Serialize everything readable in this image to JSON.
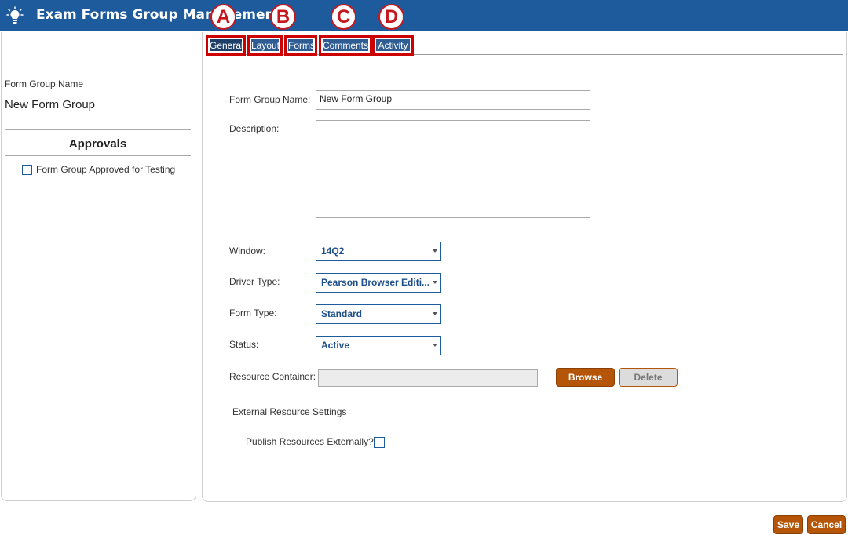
{
  "app": {
    "title": "Exam Forms Group Management"
  },
  "callouts": [
    "A",
    "B",
    "C",
    "D"
  ],
  "tabs": [
    {
      "label": "General",
      "active": true
    },
    {
      "label": "Layout"
    },
    {
      "label": "Forms"
    },
    {
      "label": "Comments"
    },
    {
      "label": "Activity"
    }
  ],
  "sidebar": {
    "form_group_name_label": "Form Group Name",
    "form_group_name_value": "New Form Group",
    "approvals_heading": "Approvals",
    "approved_checkbox_label": "Form Group Approved for Testing",
    "approved_checked": false
  },
  "form": {
    "name_label": "Form Group Name:",
    "name_value": "New Form Group",
    "description_label": "Description:",
    "description_value": "",
    "window_label": "Window:",
    "window_value": "14Q2",
    "driver_type_label": "Driver Type:",
    "driver_type_value": "Pearson Browser Editi...",
    "form_type_label": "Form Type:",
    "form_type_value": "Standard",
    "status_label": "Status:",
    "status_value": "Active",
    "resource_container_label": "Resource Container:",
    "resource_container_value": "",
    "browse_label": "Browse",
    "delete_label": "Delete",
    "external_heading": "External Resource Settings",
    "publish_label": "Publish Resources Externally?",
    "publish_checked": false
  },
  "footer": {
    "save_label": "Save",
    "cancel_label": "Cancel"
  },
  "colors": {
    "header": "#1d5b9c",
    "accent_button": "#b55507",
    "callout": "#c8161d",
    "tab": "#2f5d93"
  },
  "icons": {
    "app": "lightbulb-icon",
    "dropdown": "chevron-down-icon"
  }
}
